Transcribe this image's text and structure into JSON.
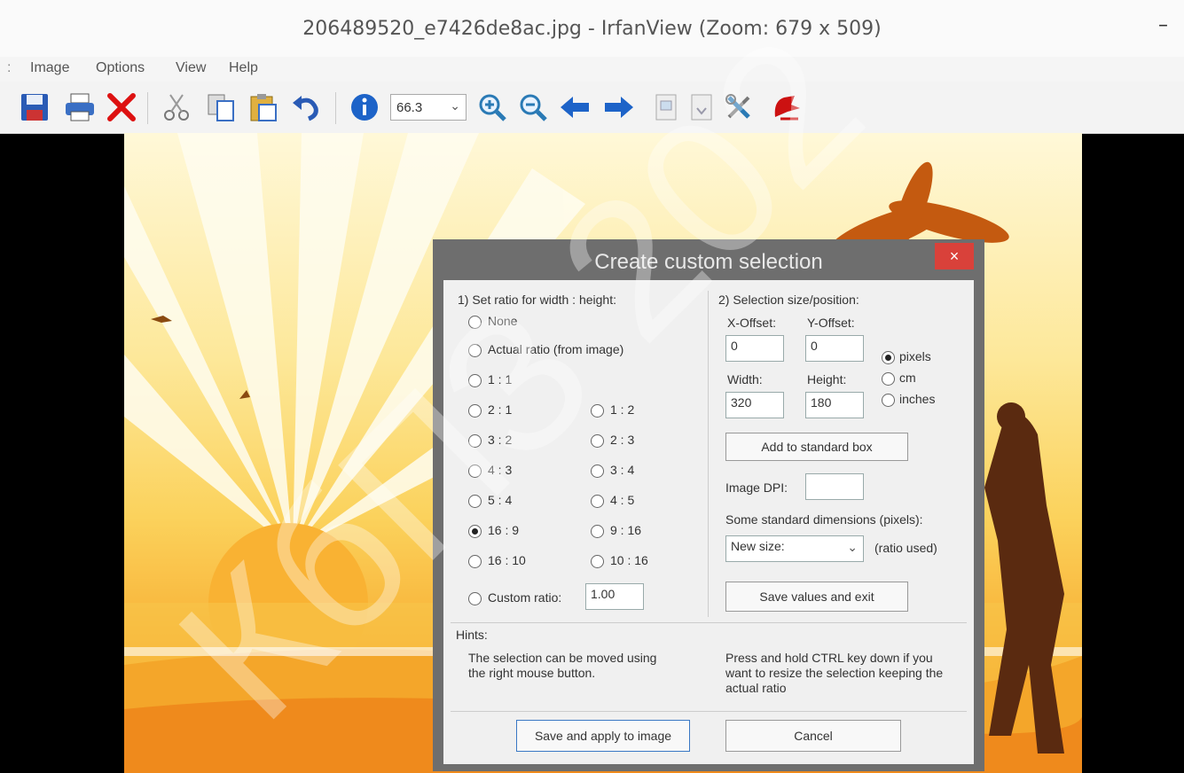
{
  "window": {
    "title": "206489520_e7426de8ac.jpg - IrfanView (Zoom: 679 x 509)",
    "minimize": "–"
  },
  "menu": [
    {
      "label": "Image"
    },
    {
      "label": "Options"
    },
    {
      "label": "View"
    },
    {
      "label": "Help"
    }
  ],
  "toolbar": {
    "zoom_value": "66.3",
    "icons": [
      "save-icon",
      "print-icon",
      "delete-icon",
      "cut-icon",
      "copy-icon",
      "paste-icon",
      "undo-icon",
      "info-icon",
      "zoom-in-icon",
      "zoom-out-icon",
      "previous-icon",
      "next-icon",
      "page-icon",
      "page-icon-2",
      "tools-icon",
      "exit-icon"
    ]
  },
  "watermark": "КбПЗ 202",
  "dialog": {
    "title": "Create custom selection",
    "close": "×",
    "ratio_group": {
      "heading": "1) Set ratio for width : height:",
      "options": [
        {
          "label": "None",
          "selected": false
        },
        {
          "label": "Actual ratio (from image)",
          "selected": false
        },
        {
          "label": "1 : 1",
          "selected": false
        },
        {
          "label": "2 : 1",
          "selected": false
        },
        {
          "label": "1 : 2",
          "selected": false
        },
        {
          "label": "3 : 2",
          "selected": false
        },
        {
          "label": "2 : 3",
          "selected": false
        },
        {
          "label": "4 : 3",
          "selected": false
        },
        {
          "label": "3 : 4",
          "selected": false
        },
        {
          "label": "5 : 4",
          "selected": false
        },
        {
          "label": "4 : 5",
          "selected": false
        },
        {
          "label": "16 : 9",
          "selected": true
        },
        {
          "label": "9 : 16",
          "selected": false
        },
        {
          "label": "16 : 10",
          "selected": false
        },
        {
          "label": "10 : 16",
          "selected": false
        }
      ],
      "custom_label": "Custom ratio:",
      "custom_value": "1.00"
    },
    "size_group": {
      "heading": "2) Selection size/position:",
      "x_offset_label": "X-Offset:",
      "x_offset_value": "0",
      "y_offset_label": "Y-Offset:",
      "y_offset_value": "0",
      "width_label": "Width:",
      "width_value": "320",
      "height_label": "Height:",
      "height_value": "180",
      "units": [
        {
          "label": "pixels",
          "selected": true
        },
        {
          "label": "cm",
          "selected": false
        },
        {
          "label": "inches",
          "selected": false
        }
      ],
      "add_button": "Add to standard box",
      "dpi_label": "Image DPI:",
      "dpi_value": "",
      "std_label": "Some standard dimensions (pixels):",
      "std_select": "New size:",
      "std_note": "(ratio used)",
      "save_values_button": "Save values and exit"
    },
    "hints": {
      "heading": "Hints:",
      "left": "The selection can be moved using the right mouse button.",
      "right": "Press and hold CTRL key down if you want to resize the selection keeping the actual ratio"
    },
    "apply_button": "Save and apply to image",
    "cancel_button": "Cancel"
  }
}
